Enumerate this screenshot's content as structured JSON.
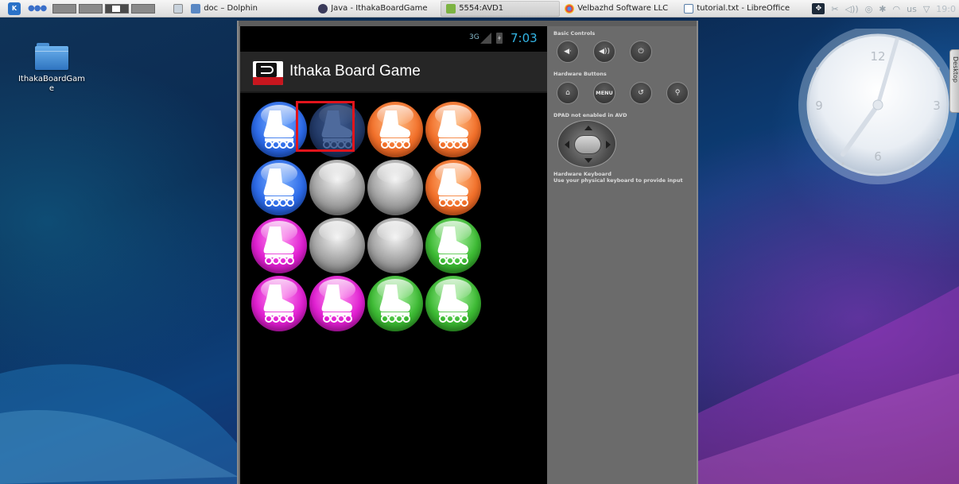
{
  "taskbar": {
    "tasks": [
      {
        "label": "doc – Dolphin",
        "icon": "folder-icon"
      },
      {
        "label": "Java - IthakaBoardGame",
        "icon": "eclipse-icon"
      },
      {
        "label": "5554:AVD1",
        "icon": "android-icon"
      },
      {
        "label": "Velbazhd Software LLC",
        "icon": "chrome-icon"
      },
      {
        "label": "tutorial.txt - LibreOffice",
        "icon": "document-icon"
      }
    ],
    "tray": {
      "keyboard_layout": "us",
      "clock": "19:0"
    }
  },
  "desktop": {
    "icons": [
      {
        "label": "IthakaBoardGame",
        "icon": "folder-icon"
      }
    ],
    "side_tab": "Desktop"
  },
  "android": {
    "status_bar": {
      "network": "3G",
      "time": "7:03"
    },
    "action_bar": {
      "title": "Ithaka Board Game"
    },
    "board": [
      [
        "blue",
        "dark-blue",
        "orange",
        "orange"
      ],
      [
        "blue",
        "gray",
        "gray",
        "orange"
      ],
      [
        "magenta",
        "gray",
        "gray",
        "green"
      ],
      [
        "magenta",
        "magenta",
        "green",
        "green"
      ]
    ],
    "selected_cell": {
      "row": 0,
      "col": 1
    }
  },
  "emulator_controls": {
    "basic_controls_label": "Basic Controls",
    "hardware_buttons_label": "Hardware Buttons",
    "menu_label": "MENU",
    "dpad_label": "DPAD not enabled in AVD",
    "keyboard_title": "Hardware Keyboard",
    "keyboard_hint": "Use your physical keyboard to provide input"
  },
  "clock_widget": {
    "numerals": [
      "12",
      "3",
      "6",
      "9"
    ]
  }
}
